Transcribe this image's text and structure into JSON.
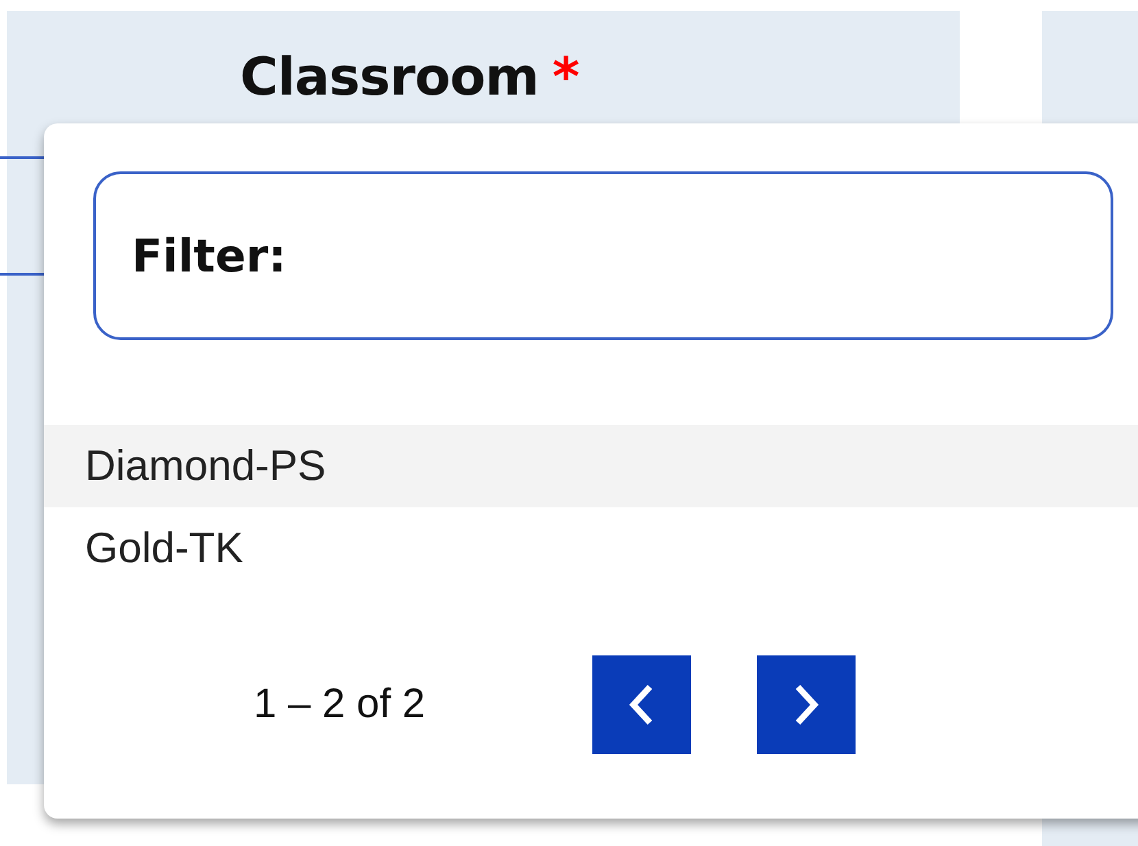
{
  "column_header": {
    "label": "Classroom",
    "required_mark": "*"
  },
  "dropdown": {
    "filter_label": "Filter:",
    "options": [
      {
        "label": "Diamond-PS",
        "highlighted": true
      },
      {
        "label": "Gold-TK",
        "highlighted": false
      }
    ],
    "pagination": {
      "range": "1 – 2 of 2",
      "prev_disabled": false,
      "next_disabled": false
    }
  }
}
